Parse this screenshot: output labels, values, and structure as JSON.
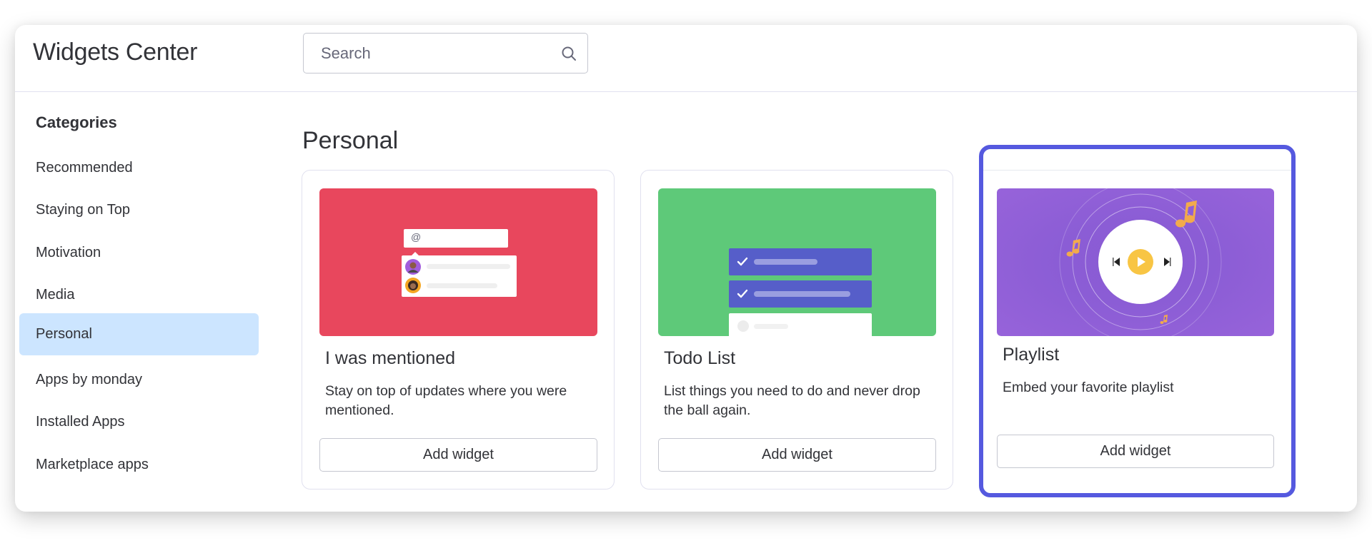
{
  "header": {
    "title": "Widgets Center",
    "search": {
      "placeholder": "Search",
      "value": "",
      "icon": "search-icon"
    }
  },
  "sidebar": {
    "heading": "Categories",
    "items": [
      {
        "label": "Recommended",
        "active": false
      },
      {
        "label": "Staying on Top",
        "active": false
      },
      {
        "label": "Motivation",
        "active": false
      },
      {
        "label": "Media",
        "active": false
      },
      {
        "label": "Personal",
        "active": true
      },
      {
        "label": "Apps by monday",
        "active": false
      },
      {
        "label": "Installed Apps",
        "active": false
      },
      {
        "label": "Marketplace apps",
        "active": false
      }
    ]
  },
  "main": {
    "section_title": "Personal",
    "widgets": [
      {
        "title": "I was mentioned",
        "description": "Stay on top of updates where you were mentioned.",
        "button_label": "Add widget",
        "preview_color": "#e8475d",
        "preview_input_text": "@",
        "selected": false
      },
      {
        "title": "Todo List",
        "description": "List things you need to do and never drop the ball again.",
        "button_label": "Add widget",
        "preview_color": "#5ec979",
        "selected": false
      },
      {
        "title": "Playlist",
        "description": "Embed your favorite playlist",
        "button_label": "Add widget",
        "preview_color": "#8b5dd5",
        "selected": true
      }
    ]
  },
  "colors": {
    "accent": "#5559df",
    "active_category_bg": "#cce5ff",
    "todo_row": "#565ec9",
    "play_button": "#f8c544",
    "music_note": "#f2aa4c"
  }
}
